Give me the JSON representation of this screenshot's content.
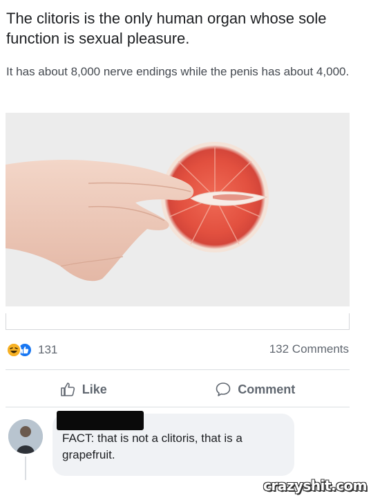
{
  "post": {
    "title": "The clitoris is the only human organ whose sole function is sexual pleasure.",
    "subtitle": "It has about 8,000 nerve endings while the penis has about 4,000."
  },
  "engagement": {
    "reaction_icons": [
      "haha-icon",
      "like-reaction-icon"
    ],
    "reaction_count": "131",
    "comments_count": "132 Comments"
  },
  "actions": {
    "like_label": "Like",
    "comment_label": "Comment"
  },
  "comment": {
    "text": "FACT: that is not a clitoris, that is a grapefruit."
  },
  "watermark": "crazyshit.com",
  "colors": {
    "like_blue": "#1877f2",
    "haha_yellow": "#f7b125",
    "grapefruit": "#e2503f",
    "text_secondary": "#606770"
  }
}
